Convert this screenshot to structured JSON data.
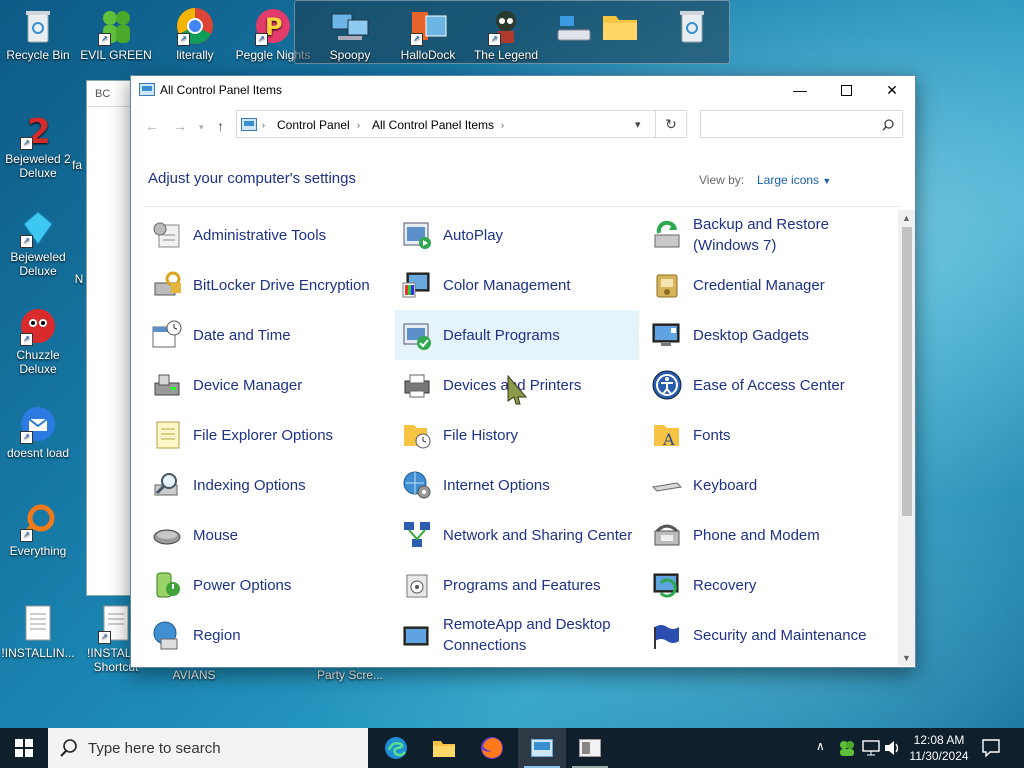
{
  "desktop": {
    "icons": [
      {
        "label": "Recycle Bin"
      },
      {
        "label": "EVIL GREEN MEN C..."
      },
      {
        "label": "literally"
      },
      {
        "label": "Peggle Nights"
      },
      {
        "label": "Spoopy"
      },
      {
        "label": "HalloDock"
      },
      {
        "label": "The Legend"
      },
      {
        "label": "Bejeweled 2 Deluxe"
      },
      {
        "label": "Bejeweled Deluxe"
      },
      {
        "label": "Chuzzle Deluxe"
      },
      {
        "label": "doesnt load"
      },
      {
        "label": "Everything"
      },
      {
        "label": "!INSTALLIN..."
      },
      {
        "label": "!INSTALL - Shortcut"
      },
      {
        "label": "AVIANS"
      },
      {
        "label": "Party Scre..."
      }
    ],
    "ghost_title": "BC",
    "ghost_side_labels": [
      "fa",
      "N"
    ]
  },
  "window": {
    "title": "All Control Panel Items",
    "breadcrumbs": [
      "Control Panel",
      "All Control Panel Items"
    ],
    "search_placeholder": "",
    "heading": "Adjust your computer's settings",
    "view_by_label": "View by:",
    "view_by_value": "Large icons",
    "items": [
      [
        "Administrative Tools",
        "AutoPlay",
        "Backup and Restore (Windows 7)"
      ],
      [
        "BitLocker Drive Encryption",
        "Color Management",
        "Credential Manager"
      ],
      [
        "Date and Time",
        "Default Programs",
        "Desktop Gadgets"
      ],
      [
        "Device Manager",
        "Devices and Printers",
        "Ease of Access Center"
      ],
      [
        "File Explorer Options",
        "File History",
        "Fonts"
      ],
      [
        "Indexing Options",
        "Internet Options",
        "Keyboard"
      ],
      [
        "Mouse",
        "Network and Sharing Center",
        "Phone and Modem"
      ],
      [
        "Power Options",
        "Programs and Features",
        "Recovery"
      ],
      [
        "Region",
        "RemoteApp and Desktop Connections",
        "Security and Maintenance"
      ]
    ],
    "selected_item": "Default Programs"
  },
  "taskbar": {
    "search_placeholder": "Type here to search",
    "time": "12:08 AM",
    "date": "11/30/2024"
  },
  "colors": {
    "link_blue": "#1e3287",
    "selection": "#e5f3fb",
    "taskbar": "#101f2c"
  }
}
